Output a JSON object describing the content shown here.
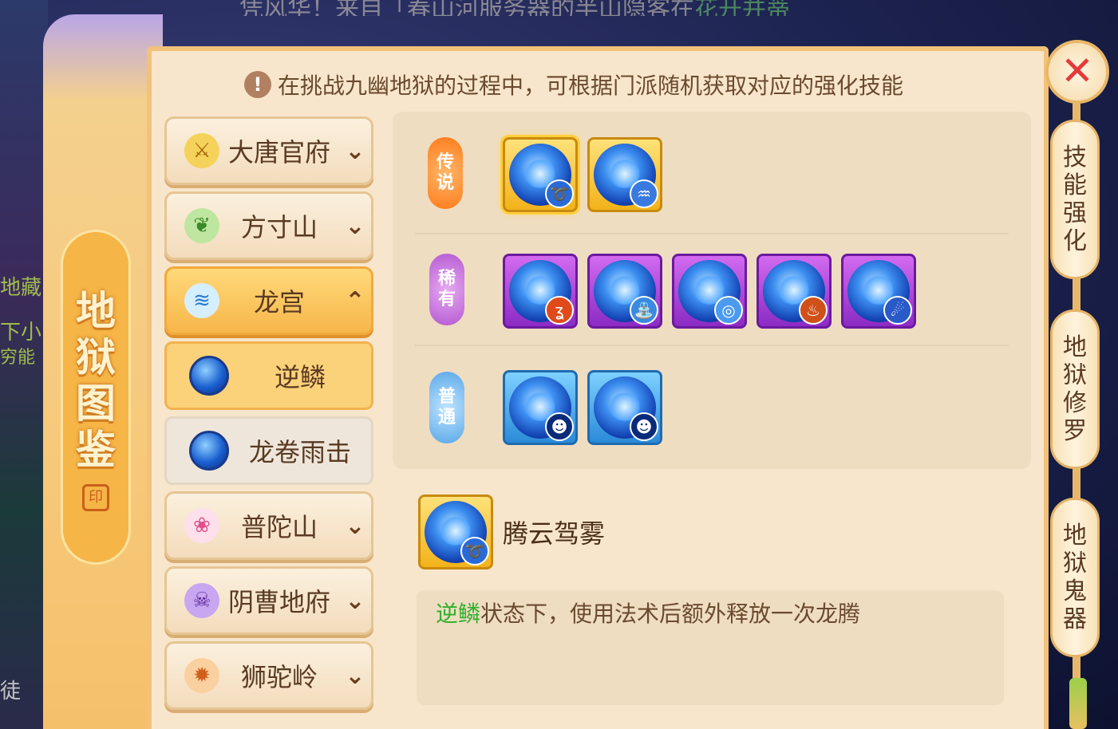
{
  "background": {
    "ticker_text": "凭风华！来自「春山河服务器的半山隐客在",
    "ticker_highlight": "花开并蒂",
    "left_texts": [
      "地藏",
      "下小",
      "穷能",
      "徒"
    ]
  },
  "side_title": {
    "chars": [
      "地",
      "狱",
      "图",
      "鉴"
    ],
    "seal": "印"
  },
  "notice": {
    "icon": "warning-icon",
    "text": "在挑战九幽地狱的过程中，可根据门派随机获取对应的强化技能"
  },
  "sects": {
    "datang": {
      "label": "大唐官府",
      "icon": "sword-icon"
    },
    "fangcun": {
      "label": "方寸山",
      "icon": "leaf-icon"
    },
    "longgong": {
      "label": "龙宫",
      "icon": "wave-icon"
    },
    "putuo": {
      "label": "普陀山",
      "icon": "lotus-icon"
    },
    "yincao": {
      "label": "阴曹地府",
      "icon": "skull-icon"
    },
    "shituo": {
      "label": "狮驼岭",
      "icon": "lion-icon"
    }
  },
  "sub_items": {
    "nilin": "逆鳞",
    "longjuan": "龙卷雨击"
  },
  "tiers": {
    "legend": "传说",
    "rare": "稀有",
    "common": "普通"
  },
  "detail": {
    "name": "腾云驾雾",
    "desc_highlight": "逆鳞",
    "desc_rest": "状态下，使用法术后额外释放一次龙腾"
  },
  "side_tabs": {
    "skill": "技能强化",
    "xiuluo": "地狱修罗",
    "guiqi": "地狱鬼器"
  },
  "close_label": "✕",
  "colors": {
    "panel": "#f8e6cc",
    "gold_frame": "#f3b21a",
    "purple_frame": "#8b2bc4",
    "blue_frame": "#2b8ad8",
    "highlight_green": "#2fb02b"
  }
}
